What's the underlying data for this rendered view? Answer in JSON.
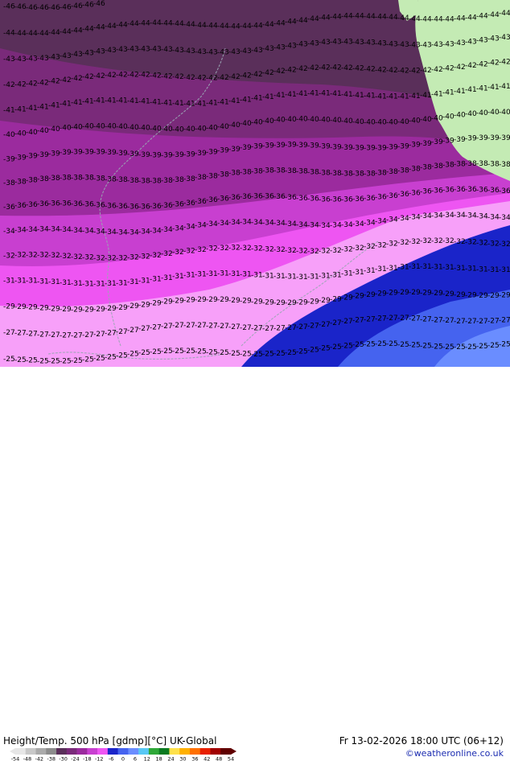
{
  "header": {
    "title": "Height/Temp. 500 hPa [gdmp][°C] UK-Global",
    "valid_time": "Fr 13-02-2026 18:00 UTC (06+12)",
    "credit": "©weatheronline.co.uk"
  },
  "colors": {
    "land": "#c4ebb4",
    "temp_bands": [
      "#5a2f5a",
      "#7a2a7a",
      "#9b2b9e",
      "#c83fd0",
      "#ee55f2",
      "#f7a0f9",
      "#1a24c9",
      "#4563ef",
      "#6a8dff"
    ]
  },
  "legend": {
    "ticks": [
      "-54",
      "-48",
      "-42",
      "-38",
      "-30",
      "-24",
      "-18",
      "-12",
      "-6",
      "0",
      "6",
      "12",
      "18",
      "24",
      "30",
      "36",
      "42",
      "48",
      "54"
    ],
    "colors": [
      "#e6e6e6",
      "#c8c8c8",
      "#aaaaaa",
      "#8c8c8c",
      "#5a2f5a",
      "#7a2a7a",
      "#9b2b9e",
      "#c83fd0",
      "#ee55f2",
      "#1a24c9",
      "#4563ef",
      "#6a8dff",
      "#58c8f5",
      "#2ea838",
      "#0a7a20",
      "#ffe14a",
      "#ffb000",
      "#ff7000",
      "#e82000",
      "#a00000",
      "#600000"
    ]
  },
  "isotherms": [
    {
      "value": "-46",
      "row": 0
    },
    {
      "value": "-44",
      "row": 1
    },
    {
      "value": "-43",
      "row": 2
    },
    {
      "value": "-42",
      "row": 3
    },
    {
      "value": "-41",
      "row": 4
    },
    {
      "value": "-40",
      "row": 5
    },
    {
      "value": "-39",
      "row": 6
    },
    {
      "value": "-38",
      "row": 7
    },
    {
      "value": "-36",
      "row": 8
    },
    {
      "value": "-34",
      "row": 9
    },
    {
      "value": "-32",
      "row": 10
    },
    {
      "value": "-31",
      "row": 11
    },
    {
      "value": "-29",
      "row": 12
    },
    {
      "value": "-27",
      "row": 13
    },
    {
      "value": "-25",
      "row": 14
    }
  ]
}
